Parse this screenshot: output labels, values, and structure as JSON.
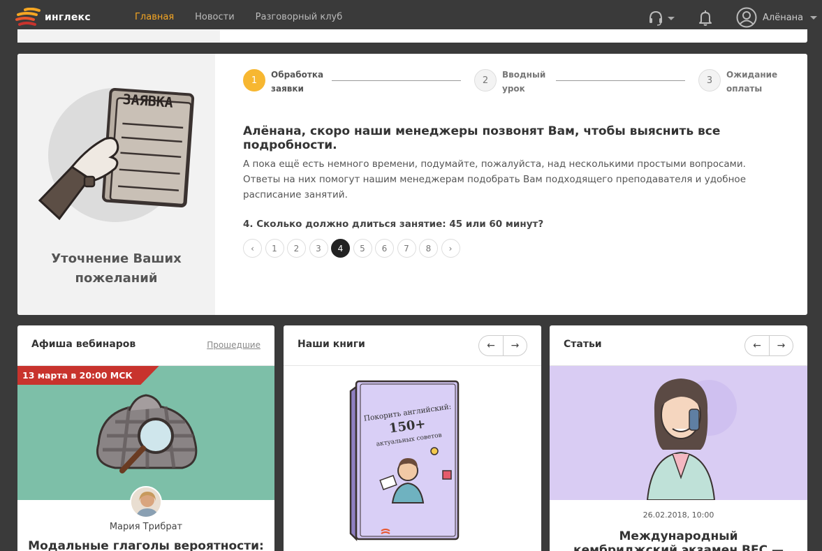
{
  "header": {
    "logo_text": "инглекс",
    "nav": [
      {
        "label": "Главная",
        "active": true
      },
      {
        "label": "Новости",
        "active": false
      },
      {
        "label": "Разговорный клуб",
        "active": false
      }
    ],
    "support_icon": "headset-icon",
    "notifications_icon": "bell-icon",
    "user_name": "Алёнана"
  },
  "application": {
    "sidebar_title": "Уточнение Ваших пожеланий",
    "illustration_text": "ЗАЯВКА",
    "steps": [
      {
        "num": "1",
        "label": "Обработка заявки",
        "active": true
      },
      {
        "num": "2",
        "label": "Вводный урок",
        "active": false
      },
      {
        "num": "3",
        "label": "Ожидание оплаты",
        "active": false
      }
    ],
    "heading": "Алёнана, скоро наши менеджеры позвонят Вам, чтобы выяснить все подробности.",
    "text": "А пока ещё есть немного времени, подумайте, пожалуйста, над несколькими простыми вопросами. Ответы на них помогут нашим менеджерам подобрать Вам подходящего преподавателя и удобное расписание занятий.",
    "question": "4. Сколько должно длиться занятие: 45 или 60 минут?",
    "pager": {
      "prev": "‹",
      "next": "›",
      "pages": [
        "1",
        "2",
        "3",
        "4",
        "5",
        "6",
        "7",
        "8"
      ],
      "current": "4"
    }
  },
  "webinars": {
    "title": "Афиша вебинаров",
    "link": "Прошедшие",
    "date_badge": "13 марта в 20:00 МСК",
    "speaker": "Мария Трибрат",
    "webinar_title": "Модальные глаголы вероятности:"
  },
  "books": {
    "title": "Наши книги",
    "prev": "←",
    "next": "→",
    "book_line1": "Покорить английский:",
    "book_line2": "150+",
    "book_line3": "актуальных советов"
  },
  "articles": {
    "title": "Статьи",
    "prev": "←",
    "next": "→",
    "date": "26.02.2018, 10:00",
    "article_title": "Международный кембриджский экзамен BEC — для бизнеса и"
  },
  "colors": {
    "accent": "#f5a623",
    "step_active": "#f7b731",
    "header_bg": "#3a3a3a",
    "badge": "#c8332d",
    "webinar_bg": "#7dbfa8",
    "articles_bg": "#d9ccf3"
  }
}
